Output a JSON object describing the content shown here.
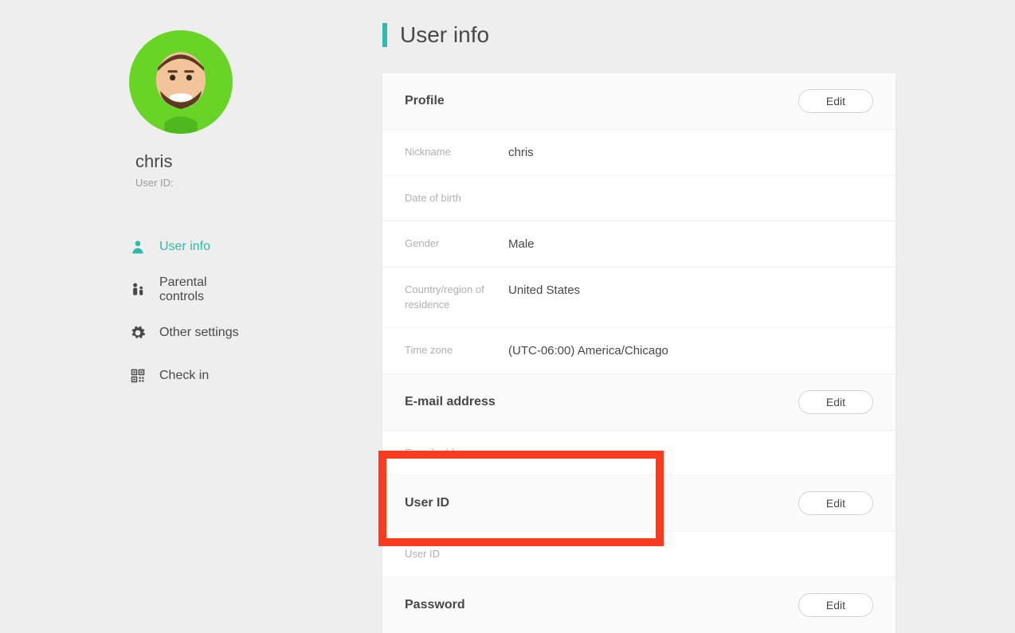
{
  "sidebar": {
    "username": "chris",
    "userid_label": "User ID:",
    "userid_value": "",
    "nav": [
      {
        "label": "User info",
        "icon": "user-icon",
        "active": true
      },
      {
        "label": "Parental controls",
        "icon": "parental-icon",
        "active": false
      },
      {
        "label": "Other settings",
        "icon": "gear-icon",
        "active": false
      },
      {
        "label": "Check in",
        "icon": "qr-icon",
        "active": false
      }
    ]
  },
  "page": {
    "title": "User info"
  },
  "sections": {
    "profile": {
      "title": "Profile",
      "edit_label": "Edit",
      "rows": {
        "nickname_label": "Nickname",
        "nickname_value": "chris",
        "dob_label": "Date of birth",
        "dob_value": "",
        "gender_label": "Gender",
        "gender_value": "Male",
        "country_label": "Country/region of residence",
        "country_value": "United States",
        "timezone_label": "Time zone",
        "timezone_value": "(UTC-06:00) America/Chicago"
      }
    },
    "email": {
      "title": "E-mail address",
      "edit_label": "Edit",
      "field_label": "E-mail address",
      "field_value": ""
    },
    "userid": {
      "title": "User ID",
      "edit_label": "Edit",
      "field_label": "User ID",
      "field_value": ""
    },
    "password": {
      "title": "Password",
      "edit_label": "Edit"
    }
  },
  "colors": {
    "accent": "#2fb8ab",
    "avatar_bg": "#67d426",
    "highlight": "#fa3b1d"
  }
}
